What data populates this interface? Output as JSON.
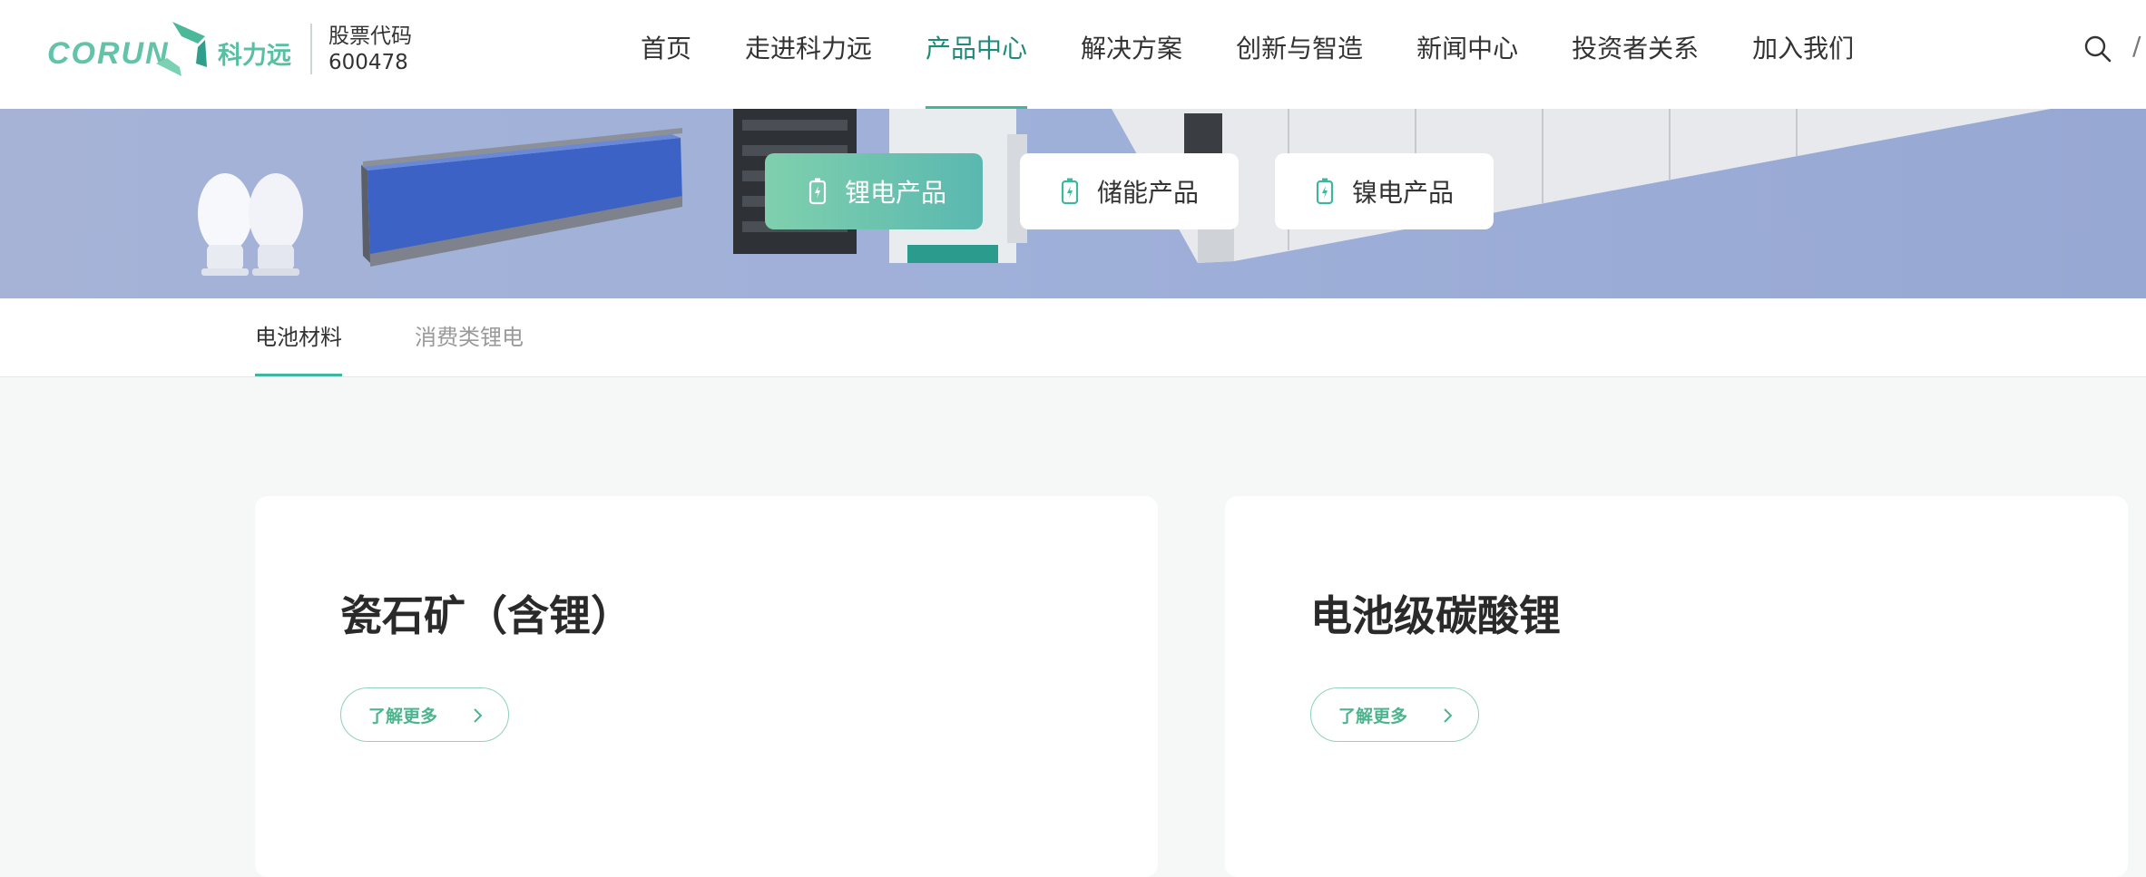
{
  "header": {
    "logo_text": "CORUN",
    "logo_cn": "科力远",
    "stock_label": "股票代码",
    "stock_code": "600478",
    "nav": [
      {
        "label": "首页",
        "active": false
      },
      {
        "label": "走进科力远",
        "active": false
      },
      {
        "label": "产品中心",
        "active": true
      },
      {
        "label": "解决方案",
        "active": false
      },
      {
        "label": "创新与智造",
        "active": false
      },
      {
        "label": "新闻中心",
        "active": false
      },
      {
        "label": "投资者关系",
        "active": false
      },
      {
        "label": "加入我们",
        "active": false
      }
    ],
    "lang_separator": "/"
  },
  "banner": {
    "categories": [
      {
        "label": "锂电产品",
        "active": true
      },
      {
        "label": "储能产品",
        "active": false
      },
      {
        "label": "镍电产品",
        "active": false
      }
    ]
  },
  "subtabs": [
    {
      "label": "电池材料",
      "active": true
    },
    {
      "label": "消费类锂电",
      "active": false
    }
  ],
  "products": [
    {
      "title": "瓷石矿（含锂）",
      "more_label": "了解更多"
    },
    {
      "title": "电池级碳酸锂",
      "more_label": "了解更多"
    }
  ],
  "colors": {
    "accent": "#3fb7a0",
    "accent_text": "#1f8a7a",
    "banner_bg": "#9fb0d9",
    "more_border": "#8fd1bc"
  }
}
